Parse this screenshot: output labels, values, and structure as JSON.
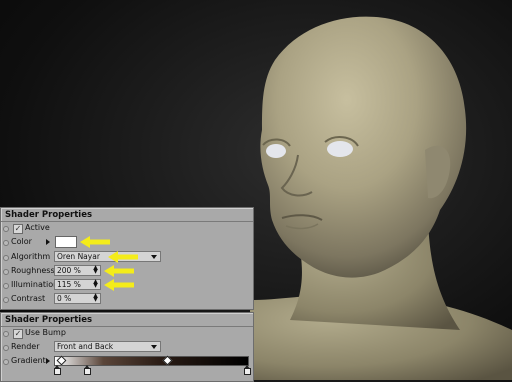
{
  "colors": {
    "panel_bg": "#a9a9a9",
    "arrow": "#f4ec1a",
    "swatch_color": "#ffffff",
    "skin": "#a7a082"
  },
  "shader_panel": {
    "title": "Shader Properties",
    "active_label": "Active",
    "active_checked": true,
    "color_label": "Color",
    "algorithm_label": "Algorithm",
    "algorithm_value": "Oren Nayar",
    "roughness_label": "Roughness",
    "roughness_value": "200 %",
    "illumination_label": "Illumination",
    "illumination_value": "115 %",
    "contrast_label": "Contrast",
    "contrast_value": "0 %"
  },
  "bump_panel": {
    "title": "Shader Properties",
    "use_bump_label": "Use Bump",
    "use_bump_checked": true,
    "render_label": "Render",
    "render_value": "Front and Back",
    "gradient_label": "Gradient"
  },
  "icons": [
    "checkbox-icon",
    "expand-triangle-icon",
    "dropdown-arrow-icon",
    "spinner-icon",
    "yellow-arrow-icon",
    "gradient-knob-icon",
    "gradient-stop-icon"
  ]
}
